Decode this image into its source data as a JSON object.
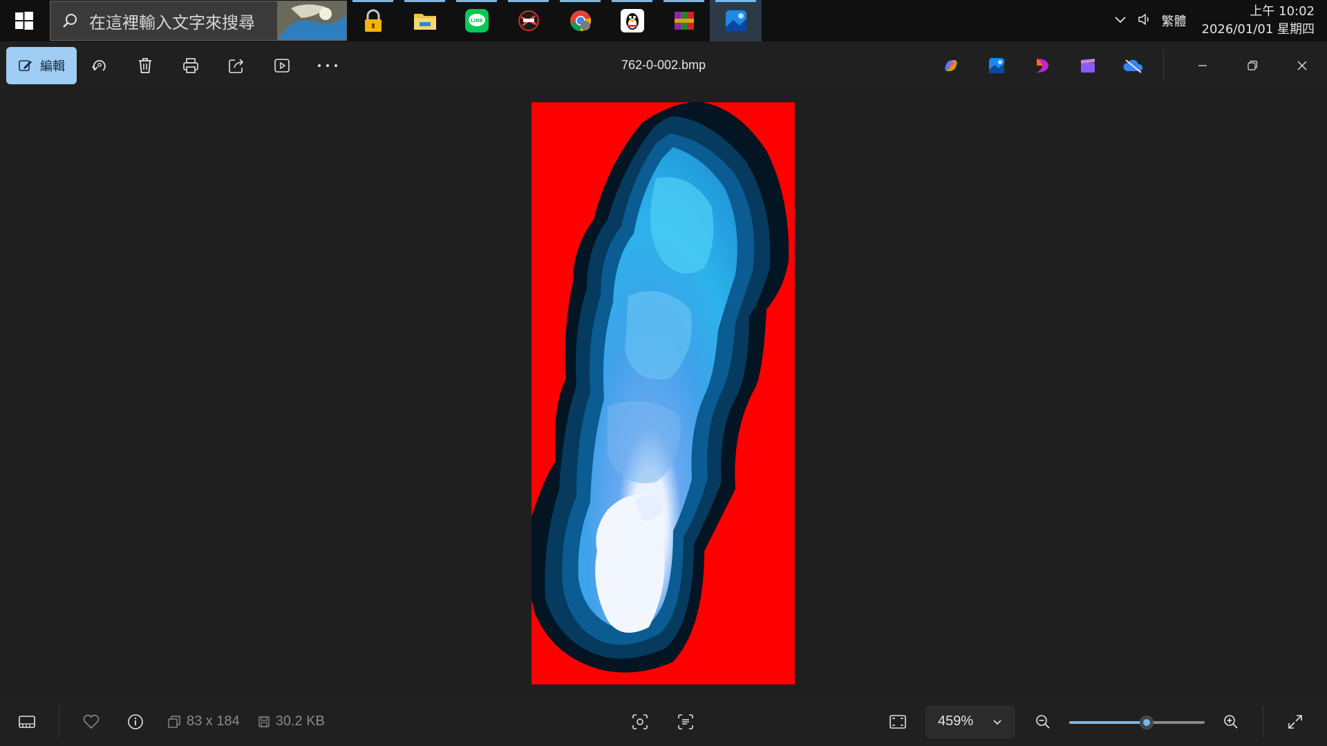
{
  "taskbar": {
    "search_placeholder": "在這裡輸入文字來搜尋",
    "apps": [
      {
        "name": "lock-app-icon",
        "running": true
      },
      {
        "name": "file-explorer-icon",
        "running": true
      },
      {
        "name": "line-app-icon",
        "running": true
      },
      {
        "name": "game-app-icon",
        "running": true
      },
      {
        "name": "chrome-icon",
        "running": true
      },
      {
        "name": "qq-penguin-icon",
        "running": true
      },
      {
        "name": "winrar-icon",
        "running": true
      },
      {
        "name": "photos-app-icon",
        "running": true,
        "active": true
      }
    ],
    "ime_label": "繁體",
    "clock_time": "上午 10:02",
    "clock_date": "2026/01/01 星期四"
  },
  "toolbar": {
    "edit_label": "編輯",
    "file_name": "762-0-002.bmp"
  },
  "viewer": {
    "image_background": "#ff0000"
  },
  "bottombar": {
    "dimensions": "83 x 184",
    "file_size": "30.2 KB",
    "zoom_label": "459%",
    "zoom_slider_fraction": 0.57
  },
  "colors": {
    "accent": "#76b9ed",
    "edit_button": "#9fcdf3",
    "background": "#1f1f1f"
  }
}
